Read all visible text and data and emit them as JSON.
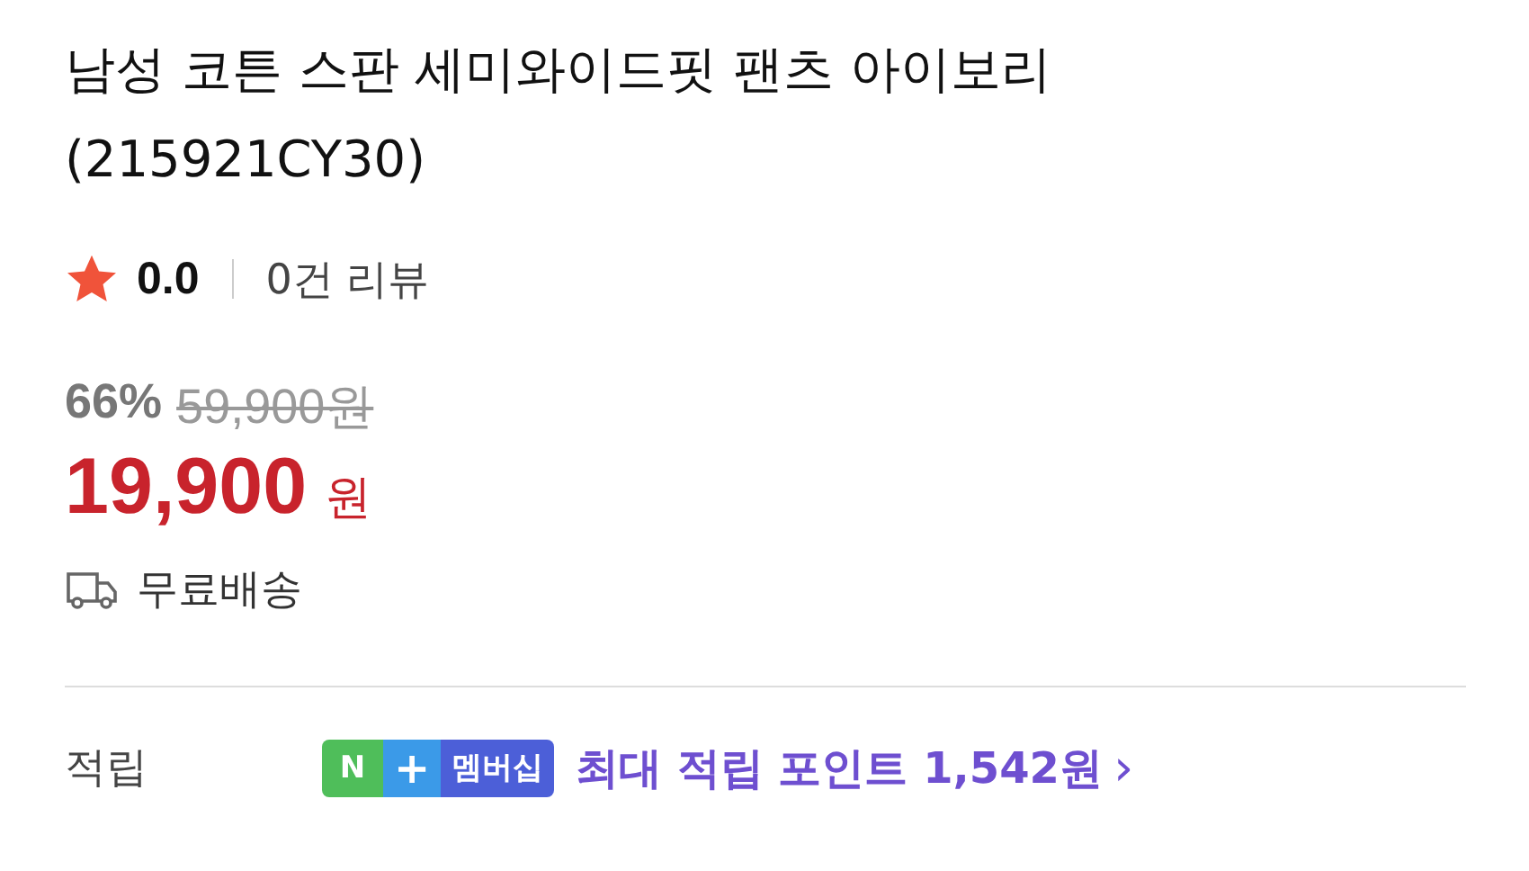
{
  "product": {
    "title": "남성 코튼 스판 세미와이드핏 팬츠 아이보리 (215921CY30)"
  },
  "rating": {
    "score": "0.0",
    "reviews": "0건 리뷰"
  },
  "price": {
    "discount": "66%",
    "original": "59,900원",
    "sale": "19,900",
    "currency": "원"
  },
  "shipping": {
    "label": "무료배송"
  },
  "points": {
    "label": "적립",
    "badge": {
      "n": "N",
      "plus": "+",
      "membership": "멤버십"
    },
    "text": "최대 적립 포인트 1,542원",
    "chevron": "›"
  }
}
